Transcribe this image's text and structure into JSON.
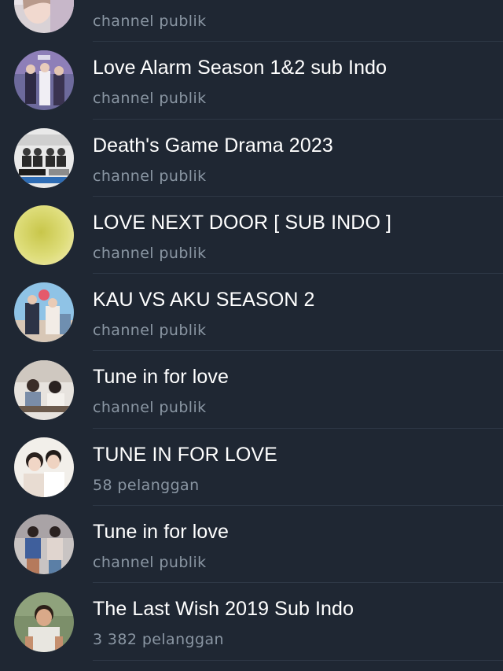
{
  "channels": [
    {
      "title": "",
      "subtitle": "channel publik",
      "avatar": "partial-portrait-avatar"
    },
    {
      "title": "Love Alarm Season 1&2 sub Indo",
      "subtitle": "channel publik",
      "avatar": "drama-poster-avatar"
    },
    {
      "title": "Death's Game Drama 2023",
      "subtitle": "channel publik",
      "avatar": "drama-poster-avatar"
    },
    {
      "title": "LOVE NEXT DOOR [ SUB INDO ]",
      "subtitle": "channel publik",
      "avatar": "blurred-yellow-avatar"
    },
    {
      "title": "KAU VS AKU SEASON 2",
      "subtitle": "channel publik",
      "avatar": "drama-poster-avatar"
    },
    {
      "title": "Tune in for love",
      "subtitle": "channel publik",
      "avatar": "couple-photo-avatar"
    },
    {
      "title": "TUNE IN FOR LOVE",
      "subtitle": "58 pelanggan",
      "avatar": "couple-photo-avatar"
    },
    {
      "title": "Tune in for love",
      "subtitle": "channel publik",
      "avatar": "couple-photo-avatar"
    },
    {
      "title": "The Last Wish 2019 Sub Indo",
      "subtitle": "3 382 pelanggan",
      "avatar": "portrait-photo-avatar"
    }
  ],
  "colors": {
    "background": "#1f2733",
    "title": "#ffffff",
    "subtitle": "#8a96a3",
    "divider": "#2e3846"
  }
}
